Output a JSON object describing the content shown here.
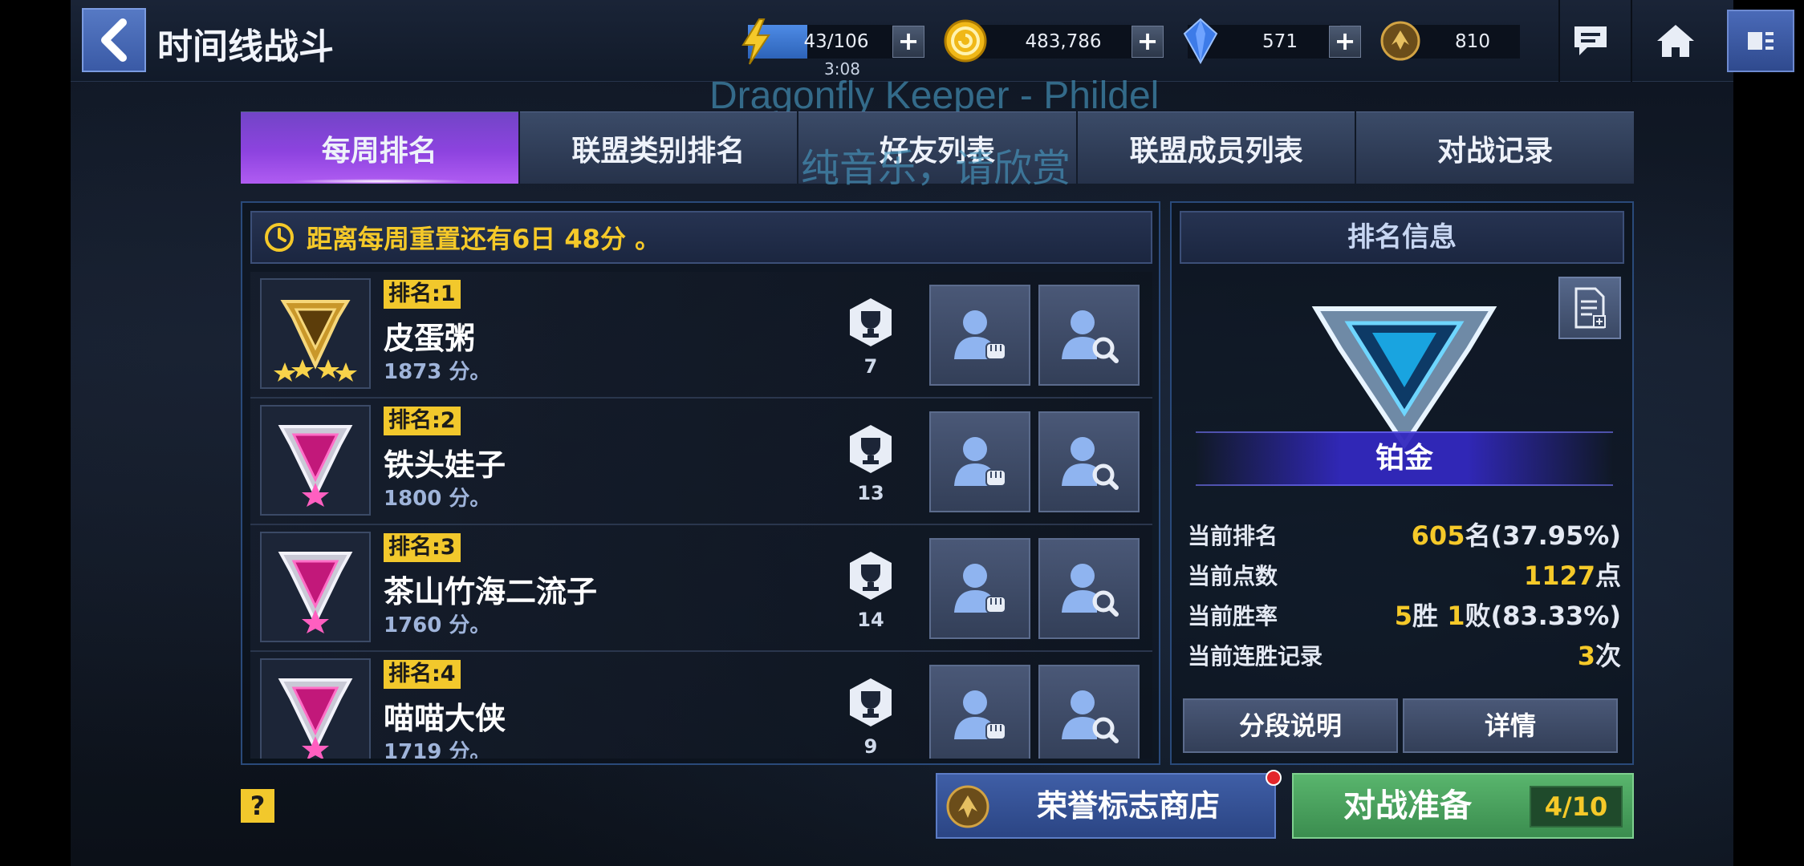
{
  "header": {
    "title": "时间线战斗",
    "energy": {
      "value": "43/106",
      "timer": "3:08",
      "fill_fraction": 0.41
    },
    "gold": {
      "value": "483,786"
    },
    "crystal": {
      "value": "571"
    },
    "honor_badge": {
      "value": "810"
    },
    "plus_label": "+"
  },
  "overlay": {
    "line1": "Dragonfly Keeper - Phildel",
    "line2": "纯音乐，请欣赏"
  },
  "tabs": [
    {
      "label": "每周排名",
      "active": true
    },
    {
      "label": "联盟类别排名",
      "active": false
    },
    {
      "label": "好友列表",
      "active": false
    },
    {
      "label": "联盟成员列表",
      "active": false
    },
    {
      "label": "对战记录",
      "active": false
    }
  ],
  "reset_notice": "距离每周重置还有6日 48分 。",
  "rankings": [
    {
      "rank_label": "排名:1",
      "name": "皮蛋粥",
      "score": "1873 分。",
      "trophies": "7",
      "tier": "gold"
    },
    {
      "rank_label": "排名:2",
      "name": "铁头娃子",
      "score": "1800 分。",
      "trophies": "13",
      "tier": "pink"
    },
    {
      "rank_label": "排名:3",
      "name": "茶山竹海二流子",
      "score": "1760 分。",
      "trophies": "14",
      "tier": "pink"
    },
    {
      "rank_label": "排名:4",
      "name": "喵喵大侠",
      "score": "1719 分。",
      "trophies": "9",
      "tier": "pink"
    }
  ],
  "rank_info": {
    "header": "排名信息",
    "tier_name": "铂金",
    "stats": [
      {
        "label": "当前排名",
        "value_highlight": "605",
        "value_rest": "名(37.95%)"
      },
      {
        "label": "当前点数",
        "value_highlight": "1127",
        "value_rest": "点"
      },
      {
        "label": "当前胜率",
        "value_highlight": "5",
        "value_mid": "胜 ",
        "value_highlight2": "1",
        "value_rest": "败(83.33%)"
      },
      {
        "label": "当前连胜记录",
        "value_highlight": "3",
        "value_rest": "次"
      }
    ],
    "btn_segment": "分段说明",
    "btn_details": "详情"
  },
  "bottom": {
    "help": "?",
    "shop_label": "荣誉标志商店",
    "battle_label": "对战准备",
    "battle_count": "4/10"
  },
  "colors": {
    "accent_yellow": "#f5c929",
    "tab_active": "#8d43df",
    "battle_green": "#4ea562",
    "shop_blue": "#3a57a0"
  }
}
